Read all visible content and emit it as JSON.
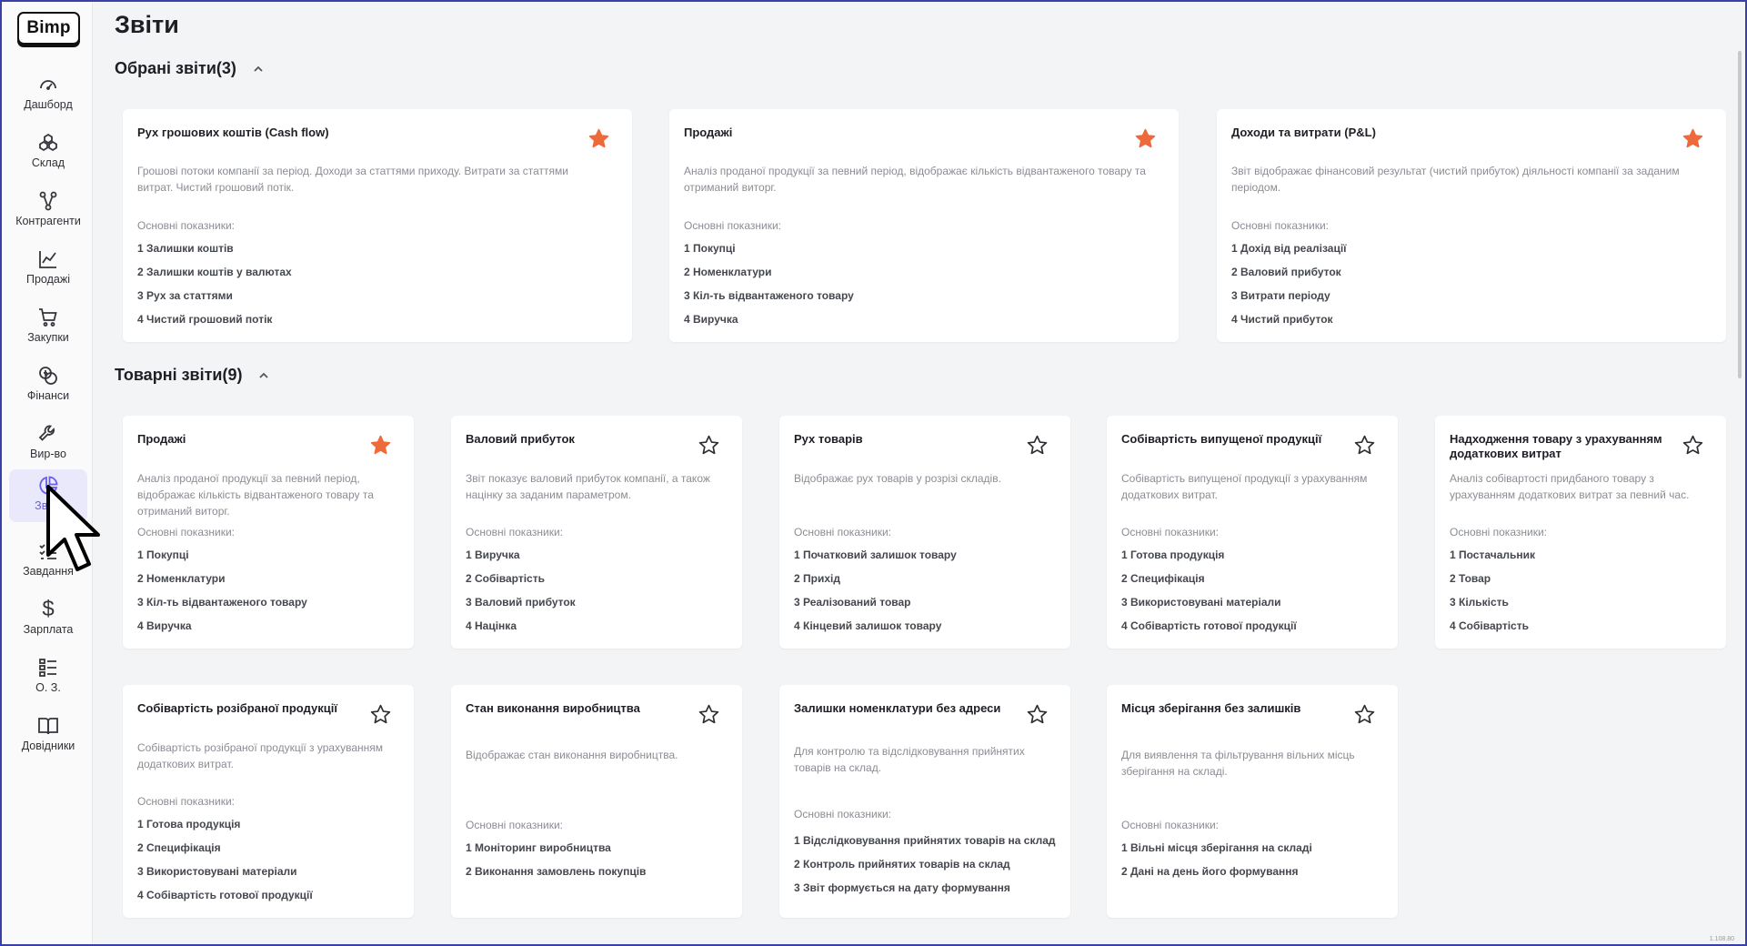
{
  "app": {
    "logo": "Bimp",
    "page_title": "Звіти",
    "version": "1.108.80"
  },
  "sidebar": {
    "items": [
      {
        "label": "Дашборд",
        "icon": "gauge-icon"
      },
      {
        "label": "Склад",
        "icon": "boxes-icon"
      },
      {
        "label": "Контрагенти",
        "icon": "nodes-icon"
      },
      {
        "label": "Продажі",
        "icon": "line-chart-icon"
      },
      {
        "label": "Закупки",
        "icon": "cart-icon"
      },
      {
        "label": "Фінанси",
        "icon": "coins-icon"
      },
      {
        "label": "Вир-во",
        "icon": "wrench-icon"
      },
      {
        "label": "Звіти",
        "icon": "pie-chart-icon",
        "active": true
      },
      {
        "label": "Завдання",
        "icon": "task-list-icon"
      },
      {
        "label": "Зарплата",
        "icon": "dollar-icon"
      },
      {
        "label": "О. З.",
        "icon": "list-icon"
      },
      {
        "label": "Довідники",
        "icon": "book-icon"
      }
    ]
  },
  "sections": [
    {
      "title": "Обрані звіти(3)",
      "cards": [
        {
          "title": "Рух грошових коштів (Cash flow)",
          "favorite": true,
          "desc": [
            "Грошові потоки компанії за період. Доходи за статтями приходу. Витрати за статтями",
            "витрат. Чистий грошовий потік."
          ],
          "kpi_label": "Основні показники:",
          "kpis": [
            "1 Залишки коштів",
            "2 Залишки коштів у валютах",
            "3 Рух за статтями",
            "4 Чистий грошовий потік"
          ]
        },
        {
          "title": "Продажі",
          "favorite": true,
          "desc": [
            "Аналіз проданої продукції за певний період, відображає кількість відвантаженого товару та",
            "отриманий виторг."
          ],
          "kpi_label": "Основні показники:",
          "kpis": [
            "1 Покупці",
            "2 Номенклатури",
            "3 Кіл-ть відвантаженого товару",
            "4 Виручка"
          ]
        },
        {
          "title": "Доходи та витрати (P&L)",
          "favorite": true,
          "desc": [
            "Звіт відображає фінансовий результат (чистий прибуток) діяльності компанії за заданим",
            "періодом."
          ],
          "kpi_label": "Основні показники:",
          "kpis": [
            "1 Дохід від реалізації",
            "2 Валовий прибуток",
            "3 Витрати періоду",
            "4 Чистий прибуток"
          ]
        }
      ]
    },
    {
      "title": "Товарні звіти(9)",
      "cards": [
        {
          "title": "Продажі",
          "favorite": true,
          "desc": [
            "Аналіз проданої продукції за певний період,",
            "відображає кількість відвантаженого товару та",
            "отриманий виторг."
          ],
          "kpi_label": "Основні показники:",
          "kpis": [
            "1 Покупці",
            "2 Номенклатури",
            "3 Кіл-ть відвантаженого товару",
            "4 Виручка"
          ]
        },
        {
          "title": "Валовий прибуток",
          "favorite": false,
          "desc": [
            "Звіт показує валовий прибуток компанії, а також",
            "націнку за заданим параметром."
          ],
          "kpi_label": "Основні показники:",
          "kpis": [
            "1 Виручка",
            "2 Собівартість",
            "3 Валовий прибуток",
            "4 Націнка"
          ]
        },
        {
          "title": "Рух товарів",
          "favorite": false,
          "desc": [
            "Відображає рух товарів у розрізі складів."
          ],
          "kpi_label": "Основні показники:",
          "kpis": [
            "1 Початковий залишок товару",
            "2 Прихід",
            "3 Реалізований товар",
            "4 Кінцевий залишок товару"
          ]
        },
        {
          "title": "Собівартість випущеної продукції",
          "favorite": false,
          "desc": [
            "Собівартість випущеної продукції з урахуванням",
            "додаткових витрат."
          ],
          "kpi_label": "Основні показники:",
          "kpis": [
            "1 Готова продукція",
            "2 Специфікація",
            "3 Використовувані матеріали",
            "4 Собівартість готової продукції"
          ]
        },
        {
          "title": "Надходження товару з урахуванням додаткових витрат",
          "title_lines": [
            "Надходження товару з урахуванням",
            "додаткових витрат"
          ],
          "favorite": false,
          "desc": [
            "Аналіз собівартості придбаного товару з",
            "урахуванням додаткових витрат за певний час."
          ],
          "kpi_label": "Основні показники:",
          "kpis": [
            "1 Постачальник",
            "2 Товар",
            "3 Кількість",
            "4 Собівартість"
          ]
        },
        {
          "title": "Собівартість розібраної продукції",
          "favorite": false,
          "desc": [
            "Собівартість розібраної продукції з урахуванням",
            "додаткових витрат."
          ],
          "kpi_label": "Основні показники:",
          "kpis": [
            "1 Готова продукція",
            "2 Специфікація",
            "3 Використовувані матеріали",
            "4 Собівартість готової продукції"
          ]
        },
        {
          "title": "Стан виконання виробництва",
          "favorite": false,
          "desc": [
            "Відображає стан виконання виробництва."
          ],
          "kpi_label": "Основні показники:",
          "kpis": [
            "1 Моніторинг виробництва",
            "2 Виконання замовлень покупців"
          ]
        },
        {
          "title": "Залишки номенклатури без адреси",
          "favorite": false,
          "desc": [
            "Для контролю та відслідковування прийнятих",
            "товарів на склад."
          ],
          "kpi_label": "Основні показники:",
          "kpis": [
            "1 Відслідковування прийнятих товарів на склад",
            "2 Контроль прийнятих товарів на склад",
            "3 Звіт формується на дату формування"
          ]
        },
        {
          "title": "Місця зберігання без залишків",
          "favorite": false,
          "desc": [
            "Для виявлення та фільтрування вільних місць",
            "зберігання на складі."
          ],
          "kpi_label": "Основні показники:",
          "kpis": [
            "1 Вільні місця зберігання на складі",
            "2 Дані на день його формування"
          ]
        }
      ]
    }
  ],
  "colors": {
    "accent": "#6a5ee8",
    "star_filled": "#ef6a3a",
    "star_empty": "#2b2d31"
  }
}
